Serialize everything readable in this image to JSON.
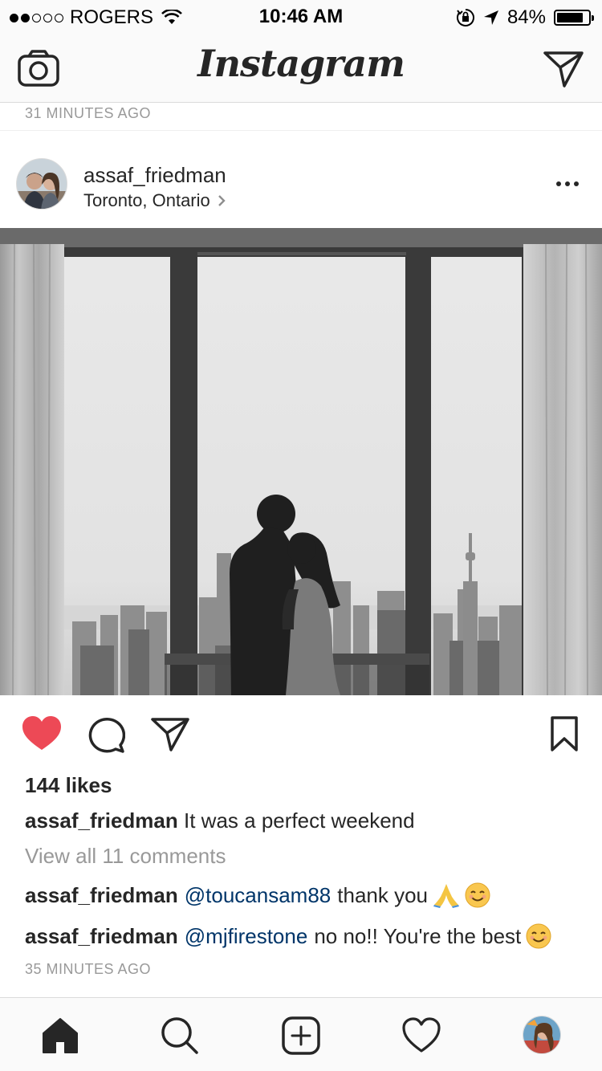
{
  "status_bar": {
    "carrier": "ROGERS",
    "time": "10:46 AM",
    "battery_percent": "84%",
    "battery_level": 0.84,
    "signal_dots_filled": 2,
    "signal_dots_total": 5
  },
  "nav": {
    "logo": "Instagram",
    "left_icon": "camera-icon",
    "right_icon": "direct-message-icon"
  },
  "previous_post": {
    "time": "31 MINUTES AGO"
  },
  "post": {
    "username": "assaf_friedman",
    "location": "Toronto, Ontario",
    "likes": "144 likes",
    "caption_user": "assaf_friedman",
    "caption_text": "It was a perfect weekend",
    "view_all": "View all 11 comments",
    "comments": [
      {
        "user": "assaf_friedman",
        "mention": "@toucansam88",
        "text": "thank you"
      },
      {
        "user": "assaf_friedman",
        "mention": "@mjfirestone",
        "text": "no no!! You're the best"
      }
    ],
    "time": "35 MINUTES AGO",
    "liked": true
  },
  "colors": {
    "like_red": "#ed4956",
    "mention_blue": "#003569",
    "muted_gray": "#999999",
    "bar_bg": "#fafafa"
  },
  "tab_bar": {
    "items": [
      "home-icon",
      "search-icon",
      "add-post-icon",
      "activity-heart-icon",
      "profile-avatar"
    ]
  }
}
